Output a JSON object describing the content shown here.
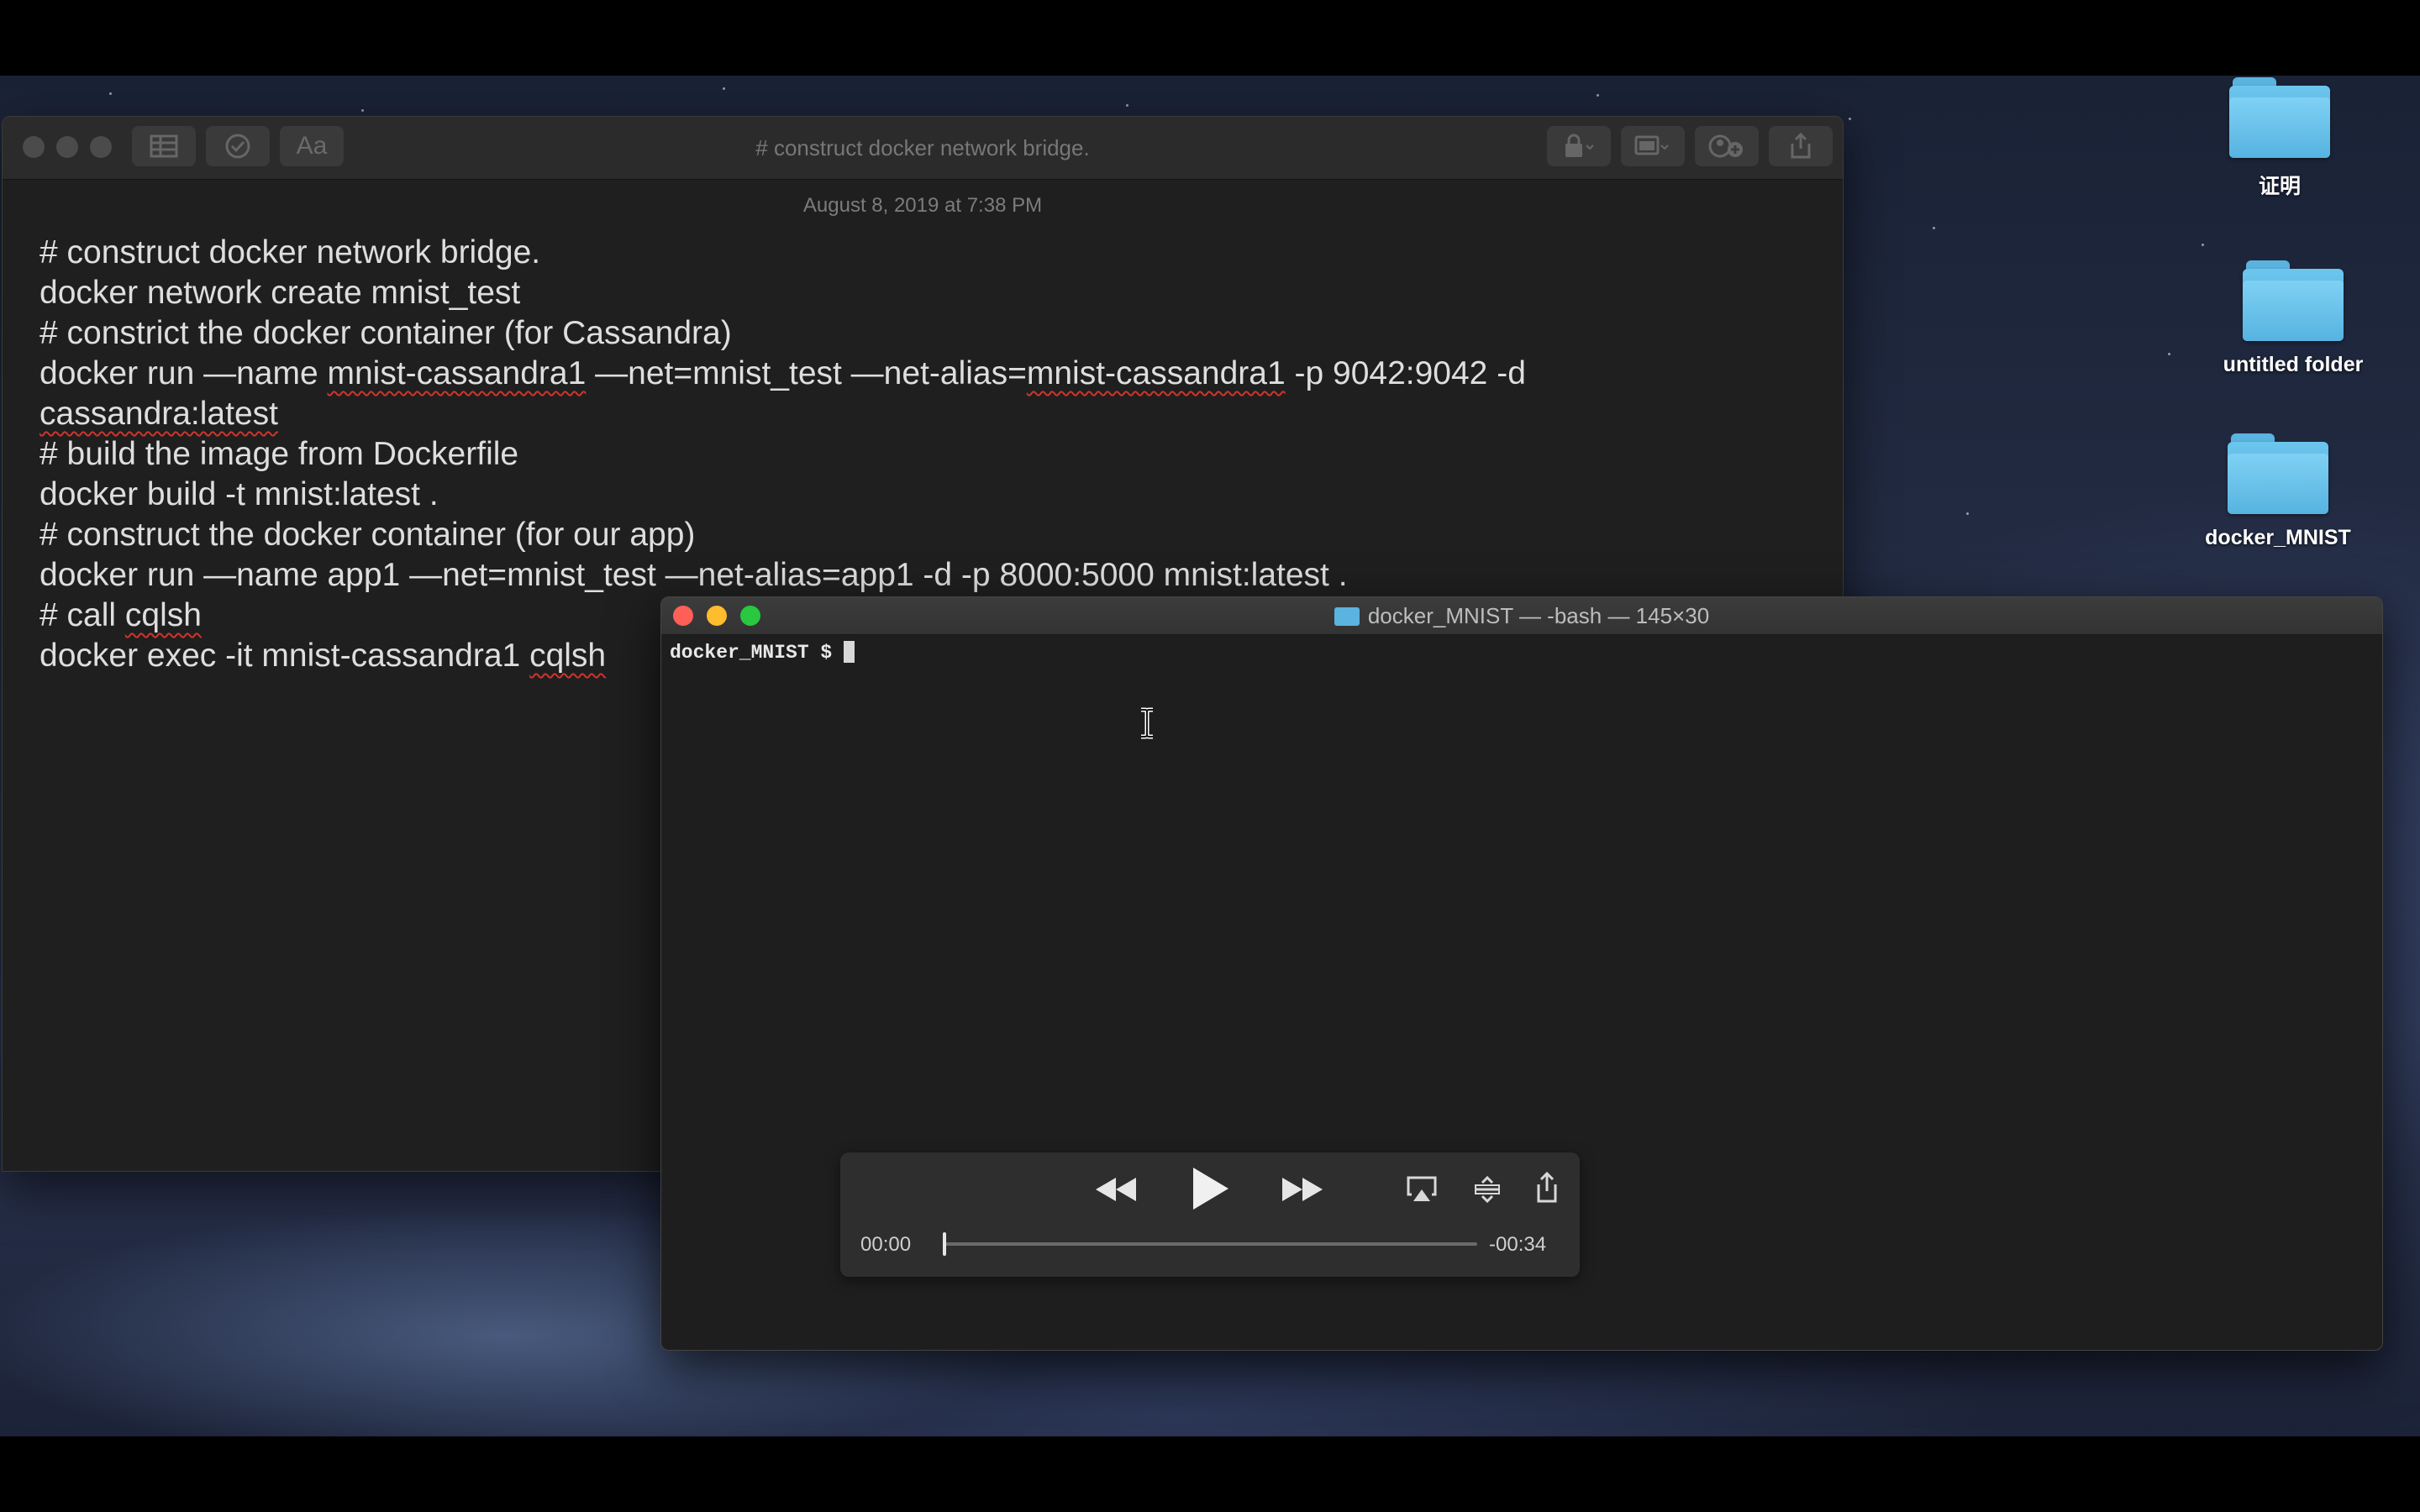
{
  "notes": {
    "title": "# construct docker network bridge.",
    "date": "August 8, 2019 at 7:38 PM",
    "toolbar": {
      "font_button": "Aa"
    }
  },
  "lines": {
    "l1": "# construct docker network bridge.",
    "l2": "docker network create mnist_test",
    "l3": "# constrict the docker container (for Cassandra)",
    "l4a": "docker run —name ",
    "l4b": "mnist-cassandra1",
    "l4c": " —net=mnist_test —net-alias=",
    "l4d": "mnist-cassandra1",
    "l4e": " -p 9042:9042 -d",
    "l5": "cassandra:latest",
    "l6": "# build the image from Dockerfile",
    "l7": "docker build -t mnist:latest .",
    "l8": "# construct the docker container  (for our app)",
    "l9": "docker run —name app1 —net=mnist_test —net-alias=app1 -d -p 8000:5000 mnist:latest .",
    "l10a": "# call ",
    "l10b": "cqlsh",
    "l11a": "docker exec -it mnist-cassandra1 ",
    "l11b": "cqlsh"
  },
  "terminal": {
    "title": "docker_MNIST — -bash — 145×30",
    "prompt": "docker_MNIST $ "
  },
  "desktop": {
    "icons": [
      {
        "label": "证明",
        "icon": "folder-icon"
      },
      {
        "label": "untitled folder",
        "icon": "folder-icon"
      },
      {
        "label": "docker_MNIST",
        "icon": "folder-icon"
      }
    ]
  },
  "player": {
    "elapsed": "00:00",
    "remaining": "-00:34",
    "progress": 0.0
  },
  "colors": {
    "close": "#fe5f57",
    "minimize": "#febc2e",
    "zoom": "#28c840",
    "folder_blue": "#5bb3df",
    "squiggle": "#d0342c"
  }
}
